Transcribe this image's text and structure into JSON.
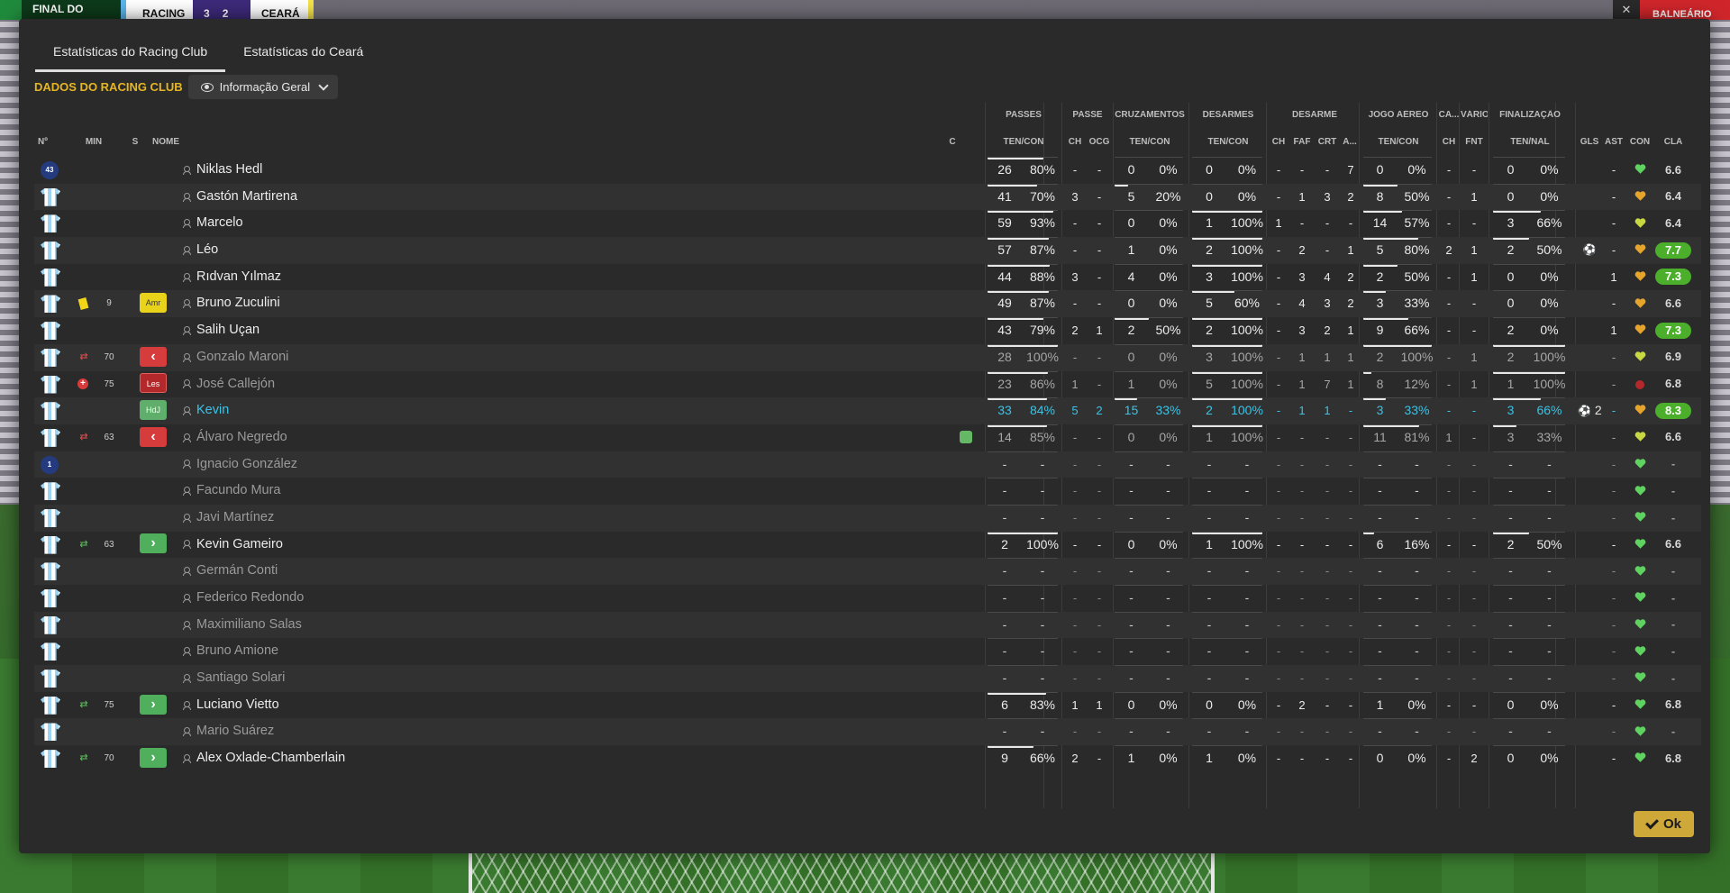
{
  "scoreboard": {
    "label": "FINAL DO",
    "home": "RACING",
    "home_score": "3",
    "away_score": "2",
    "away": "CEARÁ",
    "right_button": "BALNEÁRIO"
  },
  "tabs": [
    "Estatísticas do Racing Club",
    "Estatísticas do Ceará"
  ],
  "section_label": "DADOS DO RACING CLUB",
  "view_dropdown": "Informação Geral",
  "group_headers": [
    "PASSES",
    "PASSE",
    "CRUZAMENTOS",
    "DESARMES",
    "DESARME",
    "JOGO AÉREO",
    "CA...",
    "VÁRIOS",
    "FINALIZAÇÃO"
  ],
  "columns": {
    "no": "Nº",
    "min": "MIN",
    "s": "S",
    "name": "NOME",
    "c": "C",
    "passes": "TEN/CON",
    "passe_ch": "CH",
    "passe_ocg": "OCG",
    "cruz": "TEN/CON",
    "desarmes": "TEN/CON",
    "des_ch": "CH",
    "des_faf": "FAF",
    "des_crt": "CRT",
    "des_a": "A...",
    "aereo": "TEN/CON",
    "ca_ch": "CH",
    "fnt": "FNT",
    "fin": "TEN/NAL",
    "gls": "GLS",
    "ast": "AST",
    "con": "CON",
    "cla": "CLA"
  },
  "colors": {
    "accent": "#e6b622",
    "cla_green": "#4caf2c",
    "heart_green": "#5fd35f",
    "heart_orange": "#e6a52a",
    "heart_yellow": "#c8d840"
  },
  "players": [
    {
      "shirt": "gk",
      "num": "43",
      "ev": "",
      "min": "",
      "status": "",
      "name": "Niklas Hedl",
      "dim": false,
      "p": [
        "26",
        "80%"
      ],
      "pb": 0.8,
      "ch": "-",
      "ocg": "-",
      "cr": [
        "0",
        "0%"
      ],
      "crb": 0,
      "de": [
        "0",
        "0%"
      ],
      "deb": 0,
      "dch": "-",
      "faf": "-",
      "crt": "-",
      "da": "7",
      "ae": [
        "0",
        "0%"
      ],
      "aeb": 0,
      "cach": "-",
      "fnt": "-",
      "fi": [
        "0",
        "0%"
      ],
      "fib": 0,
      "gls": "",
      "ast": "-",
      "con": "green",
      "cla": "6.6",
      "claHi": false
    },
    {
      "shirt": "field",
      "num": "",
      "ev": "",
      "min": "",
      "status": "",
      "name": "Gastón Martirena",
      "dim": false,
      "p": [
        "41",
        "70%"
      ],
      "pb": 0.7,
      "ch": "3",
      "ocg": "-",
      "cr": [
        "5",
        "20%"
      ],
      "crb": 0.2,
      "de": [
        "0",
        "0%"
      ],
      "deb": 0,
      "dch": "-",
      "faf": "1",
      "crt": "3",
      "da": "2",
      "ae": [
        "8",
        "50%"
      ],
      "aeb": 0.5,
      "cach": "-",
      "fnt": "1",
      "fi": [
        "0",
        "0%"
      ],
      "fib": 0,
      "gls": "",
      "ast": "-",
      "con": "orange",
      "cla": "6.4",
      "claHi": false
    },
    {
      "shirt": "field",
      "num": "",
      "ev": "",
      "min": "",
      "status": "",
      "name": "Marcelo",
      "dim": false,
      "p": [
        "59",
        "93%"
      ],
      "pb": 0.93,
      "ch": "-",
      "ocg": "-",
      "cr": [
        "0",
        "0%"
      ],
      "crb": 0,
      "de": [
        "1",
        "100%"
      ],
      "deb": 1,
      "dch": "1",
      "faf": "-",
      "crt": "-",
      "da": "-",
      "ae": [
        "14",
        "57%"
      ],
      "aeb": 0.57,
      "cach": "-",
      "fnt": "-",
      "fi": [
        "3",
        "66%"
      ],
      "fib": 0.66,
      "gls": "",
      "ast": "-",
      "con": "yellow",
      "cla": "6.4",
      "claHi": false
    },
    {
      "shirt": "field",
      "num": "",
      "ev": "",
      "min": "",
      "status": "",
      "name": "Léo",
      "dim": false,
      "p": [
        "57",
        "87%"
      ],
      "pb": 0.87,
      "ch": "-",
      "ocg": "-",
      "cr": [
        "1",
        "0%"
      ],
      "crb": 0,
      "de": [
        "2",
        "100%"
      ],
      "deb": 1,
      "dch": "-",
      "faf": "2",
      "crt": "-",
      "da": "1",
      "ae": [
        "5",
        "80%"
      ],
      "aeb": 0.8,
      "cach": "2",
      "fnt": "1",
      "fi": [
        "2",
        "50%"
      ],
      "fib": 0.5,
      "gls": "ball",
      "ast": "-",
      "con": "orange",
      "cla": "7.7",
      "claHi": true
    },
    {
      "shirt": "field",
      "num": "",
      "ev": "",
      "min": "",
      "status": "",
      "name": "Rıdvan Yılmaz",
      "dim": false,
      "p": [
        "44",
        "88%"
      ],
      "pb": 0.88,
      "ch": "3",
      "ocg": "-",
      "cr": [
        "4",
        "0%"
      ],
      "crb": 0,
      "de": [
        "3",
        "100%"
      ],
      "deb": 1,
      "dch": "-",
      "faf": "3",
      "crt": "4",
      "da": "2",
      "ae": [
        "2",
        "50%"
      ],
      "aeb": 0.5,
      "cach": "-",
      "fnt": "1",
      "fi": [
        "0",
        "0%"
      ],
      "fib": 0,
      "gls": "",
      "ast": "1",
      "con": "orange",
      "cla": "7.3",
      "claHi": true
    },
    {
      "shirt": "field",
      "num": "",
      "ev": "card",
      "min": "9",
      "status": "Amr",
      "name": "Bruno Zuculini",
      "dim": false,
      "p": [
        "49",
        "87%"
      ],
      "pb": 0.87,
      "ch": "-",
      "ocg": "-",
      "cr": [
        "0",
        "0%"
      ],
      "crb": 0,
      "de": [
        "5",
        "60%"
      ],
      "deb": 0.6,
      "dch": "-",
      "faf": "4",
      "crt": "3",
      "da": "2",
      "ae": [
        "3",
        "33%"
      ],
      "aeb": 0.33,
      "cach": "-",
      "fnt": "-",
      "fi": [
        "0",
        "0%"
      ],
      "fib": 0,
      "gls": "",
      "ast": "-",
      "con": "orange",
      "cla": "6.6",
      "claHi": false
    },
    {
      "shirt": "field",
      "num": "",
      "ev": "",
      "min": "",
      "status": "",
      "name": "Salih Uçan",
      "dim": false,
      "p": [
        "43",
        "79%"
      ],
      "pb": 0.79,
      "ch": "2",
      "ocg": "1",
      "cr": [
        "2",
        "50%"
      ],
      "crb": 0.5,
      "de": [
        "2",
        "100%"
      ],
      "deb": 1,
      "dch": "-",
      "faf": "3",
      "crt": "2",
      "da": "1",
      "ae": [
        "9",
        "66%"
      ],
      "aeb": 0.66,
      "cach": "-",
      "fnt": "-",
      "fi": [
        "2",
        "0%"
      ],
      "fib": 0,
      "gls": "",
      "ast": "1",
      "con": "orange",
      "cla": "7.3",
      "claHi": true
    },
    {
      "shirt": "field",
      "num": "",
      "ev": "subout",
      "min": "70",
      "status": "out",
      "name": "Gonzalo Maroni",
      "dim": true,
      "p": [
        "28",
        "100%"
      ],
      "pb": 1,
      "ch": "-",
      "ocg": "-",
      "cr": [
        "0",
        "0%"
      ],
      "crb": 0,
      "de": [
        "3",
        "100%"
      ],
      "deb": 1,
      "dch": "-",
      "faf": "1",
      "crt": "1",
      "da": "1",
      "ae": [
        "2",
        "100%"
      ],
      "aeb": 1,
      "cach": "-",
      "fnt": "1",
      "fi": [
        "2",
        "100%"
      ],
      "fib": 1,
      "gls": "",
      "ast": "-",
      "con": "yellow",
      "cla": "6.9",
      "claHi": false
    },
    {
      "shirt": "field",
      "num": "",
      "ev": "inj",
      "min": "75",
      "status": "Les",
      "name": "José Callejón",
      "dim": true,
      "p": [
        "23",
        "86%"
      ],
      "pb": 0.86,
      "ch": "1",
      "ocg": "-",
      "cr": [
        "1",
        "0%"
      ],
      "crb": 0,
      "de": [
        "5",
        "100%"
      ],
      "deb": 1,
      "dch": "-",
      "faf": "1",
      "crt": "7",
      "da": "1",
      "ae": [
        "8",
        "12%"
      ],
      "aeb": 0.12,
      "cach": "-",
      "fnt": "1",
      "fi": [
        "1",
        "100%"
      ],
      "fib": 1,
      "gls": "",
      "ast": "-",
      "con": "red",
      "cla": "6.8",
      "claHi": false
    },
    {
      "shirt": "field",
      "num": "",
      "ev": "",
      "min": "",
      "status": "HdJ",
      "name": "Kevin",
      "dim": false,
      "hl": true,
      "p": [
        "33",
        "84%"
      ],
      "pb": 0.84,
      "ch": "5",
      "ocg": "2",
      "cr": [
        "15",
        "33%"
      ],
      "crb": 0.33,
      "de": [
        "2",
        "100%"
      ],
      "deb": 1,
      "dch": "-",
      "faf": "1",
      "crt": "1",
      "da": "-",
      "ae": [
        "3",
        "33%"
      ],
      "aeb": 0.33,
      "cach": "-",
      "fnt": "-",
      "fi": [
        "3",
        "66%"
      ],
      "fib": 0.66,
      "gls": "ball2",
      "ast": "-",
      "con": "orange",
      "cla": "8.3",
      "claHi": true
    },
    {
      "shirt": "field",
      "num": "",
      "ev": "subout",
      "min": "63",
      "status": "out",
      "name": "Álvaro Negredo",
      "dim": true,
      "cflag": true,
      "p": [
        "14",
        "85%"
      ],
      "pb": 0.85,
      "ch": "-",
      "ocg": "-",
      "cr": [
        "0",
        "0%"
      ],
      "crb": 0,
      "de": [
        "1",
        "100%"
      ],
      "deb": 1,
      "dch": "-",
      "faf": "-",
      "crt": "-",
      "da": "-",
      "ae": [
        "11",
        "81%"
      ],
      "aeb": 0.81,
      "cach": "1",
      "fnt": "-",
      "fi": [
        "3",
        "33%"
      ],
      "fib": 0.33,
      "gls": "",
      "ast": "-",
      "con": "yellow",
      "cla": "6.6",
      "claHi": false
    },
    {
      "shirt": "gk",
      "num": "1",
      "ev": "",
      "min": "",
      "status": "",
      "name": "Ignacio González",
      "dim": true,
      "empty": true,
      "con": "green",
      "cla": "-"
    },
    {
      "shirt": "field",
      "num": "",
      "ev": "",
      "min": "",
      "status": "",
      "name": "Facundo Mura",
      "dim": true,
      "empty": true,
      "con": "green",
      "cla": "-"
    },
    {
      "shirt": "field",
      "num": "",
      "ev": "",
      "min": "",
      "status": "",
      "name": "Javi Martínez",
      "dim": true,
      "empty": true,
      "con": "green",
      "cla": "-"
    },
    {
      "shirt": "field",
      "num": "",
      "ev": "subin",
      "min": "63",
      "status": "in",
      "name": "Kevin Gameiro",
      "dim": false,
      "p": [
        "2",
        "100%"
      ],
      "pb": 1,
      "ch": "-",
      "ocg": "-",
      "cr": [
        "0",
        "0%"
      ],
      "crb": 0,
      "de": [
        "1",
        "100%"
      ],
      "deb": 1,
      "dch": "-",
      "faf": "-",
      "crt": "-",
      "da": "-",
      "ae": [
        "6",
        "16%"
      ],
      "aeb": 0.16,
      "cach": "-",
      "fnt": "-",
      "fi": [
        "2",
        "50%"
      ],
      "fib": 0.5,
      "gls": "",
      "ast": "-",
      "con": "green",
      "cla": "6.6",
      "claHi": false
    },
    {
      "shirt": "field",
      "num": "",
      "ev": "",
      "min": "",
      "status": "",
      "name": "Germán Conti",
      "dim": true,
      "empty": true,
      "con": "green",
      "cla": "-"
    },
    {
      "shirt": "field",
      "num": "",
      "ev": "",
      "min": "",
      "status": "",
      "name": "Federico Redondo",
      "dim": true,
      "empty": true,
      "con": "green",
      "cla": "-"
    },
    {
      "shirt": "field",
      "num": "",
      "ev": "",
      "min": "",
      "status": "",
      "name": "Maximiliano Salas",
      "dim": true,
      "empty": true,
      "con": "green",
      "cla": "-"
    },
    {
      "shirt": "field",
      "num": "",
      "ev": "",
      "min": "",
      "status": "",
      "name": "Bruno Amione",
      "dim": true,
      "empty": true,
      "con": "green",
      "cla": "-"
    },
    {
      "shirt": "field",
      "num": "",
      "ev": "",
      "min": "",
      "status": "",
      "name": "Santiago Solari",
      "dim": true,
      "empty": true,
      "con": "green",
      "cla": "-"
    },
    {
      "shirt": "field",
      "num": "",
      "ev": "subin",
      "min": "75",
      "status": "in",
      "name": "Luciano Vietto",
      "dim": false,
      "p": [
        "6",
        "83%"
      ],
      "pb": 0.83,
      "ch": "1",
      "ocg": "1",
      "cr": [
        "0",
        "0%"
      ],
      "crb": 0,
      "de": [
        "0",
        "0%"
      ],
      "deb": 0,
      "dch": "-",
      "faf": "2",
      "crt": "-",
      "da": "-",
      "ae": [
        "1",
        "0%"
      ],
      "aeb": 0,
      "cach": "-",
      "fnt": "-",
      "fi": [
        "0",
        "0%"
      ],
      "fib": 0,
      "gls": "",
      "ast": "-",
      "con": "green",
      "cla": "6.8",
      "claHi": false
    },
    {
      "shirt": "field",
      "num": "",
      "ev": "",
      "min": "",
      "status": "",
      "name": "Mario Suárez",
      "dim": true,
      "empty": true,
      "con": "green",
      "cla": "-"
    },
    {
      "shirt": "field",
      "num": "",
      "ev": "subin",
      "min": "70",
      "status": "in",
      "name": "Alex Oxlade-Chamberlain",
      "dim": false,
      "p": [
        "9",
        "66%"
      ],
      "pb": 0.66,
      "ch": "2",
      "ocg": "-",
      "cr": [
        "1",
        "0%"
      ],
      "crb": 0,
      "de": [
        "1",
        "0%"
      ],
      "deb": 0,
      "dch": "-",
      "faf": "-",
      "crt": "-",
      "da": "-",
      "ae": [
        "0",
        "0%"
      ],
      "aeb": 0,
      "cach": "-",
      "fnt": "2",
      "fi": [
        "0",
        "0%"
      ],
      "fib": 0,
      "gls": "",
      "ast": "-",
      "con": "green",
      "cla": "6.8",
      "claHi": false
    }
  ],
  "ok_button": "Ok"
}
